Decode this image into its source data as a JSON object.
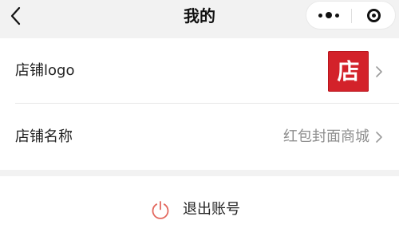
{
  "header": {
    "title": "我的",
    "back_icon": "chevron-left-icon",
    "more_icon": "more-dots-icon",
    "close_icon": "target-circle-icon"
  },
  "settings": {
    "store_logo": {
      "label": "店铺logo",
      "logo_text": "店",
      "logo_color": "#d3222a",
      "chevron_icon": "chevron-right-icon"
    },
    "store_name": {
      "label": "店铺名称",
      "value": "红包封面商城",
      "chevron_icon": "chevron-right-icon"
    }
  },
  "logout": {
    "label": "退出账号",
    "icon": "power-icon",
    "icon_color": "#e3675d"
  }
}
